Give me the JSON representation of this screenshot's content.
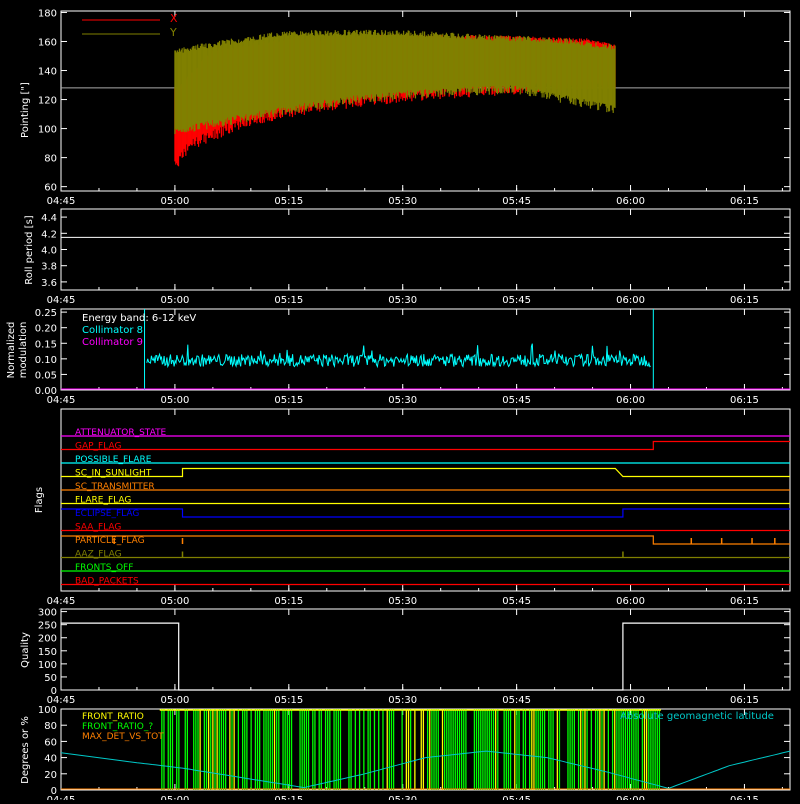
{
  "colors": {
    "background": "#000000",
    "axes": "#ffffff",
    "x_pointing": "#ff0000",
    "y_pointing": "#808000",
    "collimator_8": "#00ffff",
    "collimator_9": "#ff00ff",
    "quality": "#ffffff",
    "front_ratio": "#ffff00",
    "front_ratio_alt": "#00ff00",
    "max_det": "#ff8000",
    "geomag": "#00c8c8"
  },
  "time_axis": {
    "start_min": 285,
    "end_min": 381,
    "tick_values_min": [
      285,
      300,
      315,
      330,
      345,
      360,
      375
    ],
    "tick_labels": [
      "04:45",
      "05:00",
      "05:15",
      "05:30",
      "05:45",
      "06:00",
      "06:15"
    ]
  },
  "chart_data": [
    {
      "type": "area",
      "name": "pointing",
      "ylabel": "Pointing [\"]",
      "ylim": [
        57,
        181
      ],
      "yticks": [
        60,
        80,
        100,
        120,
        140,
        160,
        180
      ],
      "reference_line": 128,
      "legend": [
        "X",
        "Y"
      ],
      "legend_placement": "top-left",
      "series": [
        {
          "name": "X",
          "x_start": "05:00",
          "x_end": "05:58",
          "upper_envelope": [
            [
              300,
              128
            ],
            [
              305,
              155
            ],
            [
              315,
              163
            ],
            [
              330,
              165
            ],
            [
              345,
              164
            ],
            [
              355,
              162
            ],
            [
              358,
              158
            ]
          ],
          "lower_envelope": [
            [
              300,
              70
            ],
            [
              302,
              85
            ],
            [
              310,
              102
            ],
            [
              320,
              112
            ],
            [
              330,
              118
            ],
            [
              340,
              122
            ],
            [
              350,
              124
            ],
            [
              358,
              127
            ]
          ]
        },
        {
          "name": "Y",
          "x_start": "05:00",
          "x_end": "05:58",
          "upper_envelope": [
            [
              300,
              155
            ],
            [
              305,
              160
            ],
            [
              315,
              168
            ],
            [
              330,
              168
            ],
            [
              340,
              165
            ],
            [
              350,
              163
            ],
            [
              358,
              158
            ]
          ],
          "lower_envelope": [
            [
              300,
              95
            ],
            [
              305,
              100
            ],
            [
              315,
              110
            ],
            [
              325,
              118
            ],
            [
              335,
              122
            ],
            [
              345,
              124
            ],
            [
              358,
              110
            ]
          ]
        }
      ]
    },
    {
      "type": "line",
      "name": "roll_period",
      "ylabel": "Roll period [s]",
      "ylim": [
        3.5,
        4.5
      ],
      "yticks": [
        3.6,
        3.8,
        4.0,
        4.2,
        4.4
      ],
      "series": [
        {
          "name": "roll",
          "x": [
            285,
            381
          ],
          "y": [
            4.15,
            4.15
          ]
        }
      ]
    },
    {
      "type": "line",
      "name": "modulation",
      "ylabel": "Normalized modulation",
      "ylim": [
        0,
        0.26
      ],
      "yticks": [
        0.0,
        0.05,
        0.1,
        0.15,
        0.2,
        0.25
      ],
      "legend": [
        "Energy band: 6-12 keV",
        "Collimator 8",
        "Collimator 9"
      ],
      "series": [
        {
          "name": "Collimator 8",
          "x_start": 296,
          "x_end": 363,
          "mean": 0.095,
          "spread": 0.02,
          "spike_max": 0.15
        },
        {
          "name": "Collimator 9",
          "x": [
            285,
            381
          ],
          "y": [
            0.0,
            0.0
          ]
        }
      ]
    },
    {
      "type": "line",
      "name": "flags",
      "ylabel": "Flags",
      "flags": [
        {
          "label": "ATTENUATOR_STATE",
          "color": "#ff00ff",
          "steps": [
            [
              285,
              0
            ],
            [
              381,
              0
            ]
          ]
        },
        {
          "label": "GAP_FLAG",
          "color": "#ff0000",
          "steps": [
            [
              285,
              0
            ],
            [
              363,
              0
            ],
            [
              363,
              1
            ],
            [
              381,
              1
            ]
          ]
        },
        {
          "label": "POSSIBLE_FLARE",
          "color": "#00ffff",
          "steps": [
            [
              285,
              0
            ],
            [
              381,
              0
            ]
          ]
        },
        {
          "label": "SC_IN_SUNLIGHT",
          "color": "#ffff00",
          "steps": [
            [
              285,
              0
            ],
            [
              301,
              0
            ],
            [
              301,
              1
            ],
            [
              358,
              1
            ],
            [
              359,
              0
            ],
            [
              381,
              0
            ]
          ]
        },
        {
          "label": "SC_TRANSMITTER",
          "color": "#ff8000",
          "steps": [
            [
              285,
              0
            ],
            [
              381,
              0
            ]
          ]
        },
        {
          "label": "FLARE_FLAG",
          "color": "#ffff00",
          "steps": [
            [
              285,
              0
            ],
            [
              381,
              0
            ]
          ]
        },
        {
          "label": "ECLIPSE_FLAG",
          "color": "#0000ff",
          "steps": [
            [
              285,
              1
            ],
            [
              301,
              1
            ],
            [
              301,
              0
            ],
            [
              359,
              0
            ],
            [
              359,
              1
            ],
            [
              381,
              1
            ]
          ]
        },
        {
          "label": "SAA_FLAG",
          "color": "#ff0000",
          "steps": [
            [
              285,
              0
            ],
            [
              381,
              0
            ]
          ]
        },
        {
          "label": "PARTICLE_FLAG",
          "color": "#ff8000",
          "steps": [
            [
              285,
              1
            ],
            [
              363,
              1
            ],
            [
              363,
              0
            ],
            [
              381,
              0
            ]
          ]
        },
        {
          "label": "AAZ_FLAG",
          "color": "#808000",
          "steps": [
            [
              285,
              0
            ],
            [
              381,
              0
            ]
          ]
        },
        {
          "label": "FRONTS_OFF",
          "color": "#00ff00",
          "steps": [
            [
              285,
              0
            ],
            [
              381,
              0
            ]
          ]
        },
        {
          "label": "BAD_PACKETS",
          "color": "#ff0000",
          "steps": [
            [
              285,
              0
            ],
            [
              381,
              0
            ]
          ]
        }
      ]
    },
    {
      "type": "line",
      "name": "quality",
      "ylabel": "Quality",
      "ylim": [
        0,
        310
      ],
      "yticks": [
        0,
        50,
        100,
        150,
        200,
        250,
        300
      ],
      "series": [
        {
          "name": "quality",
          "x": [
            285,
            300.5,
            300.5,
            359,
            359,
            381
          ],
          "y": [
            256,
            256,
            0,
            0,
            256,
            256
          ]
        }
      ]
    },
    {
      "type": "line",
      "name": "ratios",
      "ylabel": "Degrees or %",
      "ylim": [
        0,
        100
      ],
      "yticks": [
        0,
        20,
        40,
        60,
        80,
        100
      ],
      "legend": [
        "FRONT_RATIO",
        "FRONT_RATIO_?",
        "MAX_DET_VS_TOT",
        "Absolute geomagnetic latitude"
      ],
      "series": [
        {
          "name": "geomag",
          "x": [
            285,
            293,
            301,
            309,
            317,
            325,
            333,
            341,
            349,
            357,
            365,
            373,
            381
          ],
          "y": [
            46,
            36,
            27,
            15,
            3,
            20,
            40,
            48,
            40,
            22,
            2,
            30,
            48
          ]
        },
        {
          "name": "FRONT_RATIO bars",
          "x_start": 298,
          "x_end": 364,
          "value": 100
        }
      ]
    }
  ]
}
